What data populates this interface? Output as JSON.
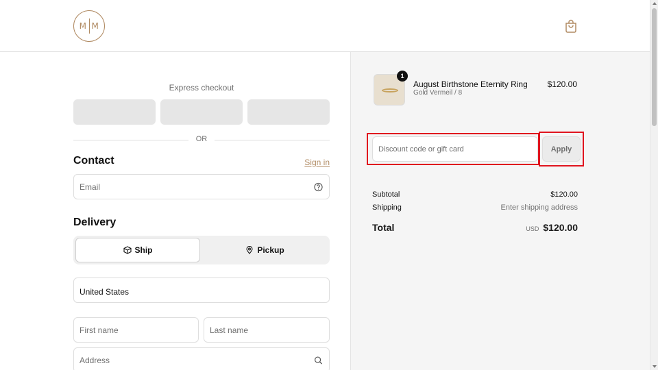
{
  "header": {
    "logo_text_left": "M",
    "logo_text_right": "M",
    "logo_color": "#b08a62",
    "bag_icon": "shopping-bag-icon"
  },
  "express": {
    "label": "Express checkout",
    "divider": "OR"
  },
  "contact": {
    "title": "Contact",
    "sign_in": "Sign in",
    "email_placeholder": "Email",
    "help_icon": "help-circle-icon"
  },
  "delivery": {
    "title": "Delivery",
    "options": [
      {
        "label": "Ship",
        "icon": "package-icon",
        "selected": true
      },
      {
        "label": "Pickup",
        "icon": "location-pin-icon",
        "selected": false
      }
    ],
    "country_label": "",
    "country_value": "United States",
    "first_name_placeholder": "First name",
    "last_name_placeholder": "Last name",
    "address_placeholder": "Address",
    "search_icon": "search-icon"
  },
  "order": {
    "item": {
      "quantity": "1",
      "name": "August Birthstone Eternity Ring",
      "variant": "Gold Vermeil / 8",
      "price": "$120.00"
    },
    "discount_placeholder": "Discount code or gift card",
    "apply_label": "Apply",
    "subtotal_label": "Subtotal",
    "subtotal_value": "$120.00",
    "shipping_label": "Shipping",
    "shipping_value": "Enter shipping address",
    "total_label": "Total",
    "currency": "USD",
    "total_value": "$120.00",
    "highlight_color": "#e0141e"
  }
}
